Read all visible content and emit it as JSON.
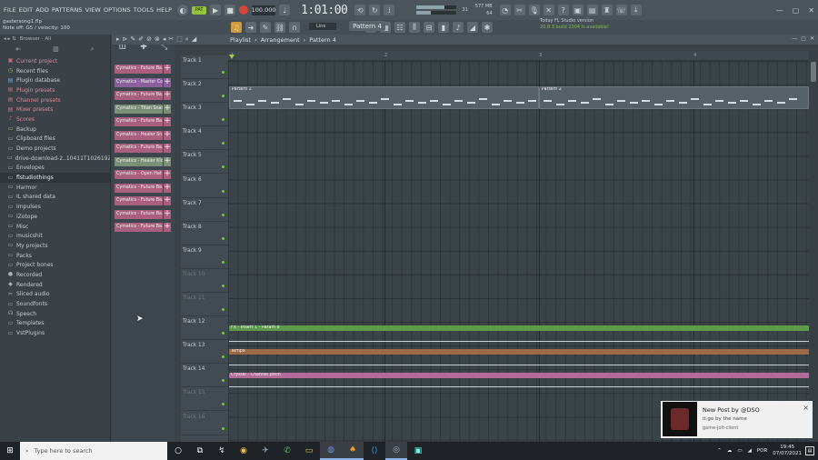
{
  "menu": [
    "FILE",
    "EDIT",
    "ADD",
    "PATTERNS",
    "VIEW",
    "OPTIONS",
    "TOOLS",
    "HELP"
  ],
  "transport": {
    "pat_label": "PAT",
    "tempo": "100.000",
    "time": "1:01:00"
  },
  "cpu": {
    "mem": "577 MB",
    "voices": "64",
    "cpu_num": "31"
  },
  "file": {
    "name": "gastersong1.flp",
    "hint": "Note off: G5 / velocity: 100"
  },
  "pattern_selector": "Pattern 4",
  "snap": "Line",
  "news": {
    "line1": "Today   FL Studio version",
    "line2": "20.8.3 build 2304 is available!"
  },
  "browser": {
    "title": "Browser - All",
    "items": [
      {
        "label": "Current project",
        "icon": "project-icon",
        "style": "pink"
      },
      {
        "label": "Recent files",
        "icon": "recent-icon",
        "style": "green"
      },
      {
        "label": "Plugin database",
        "icon": "plugin-db-icon",
        "style": "blue"
      },
      {
        "label": "Plugin presets",
        "icon": "plugin-preset-icon",
        "style": "pink"
      },
      {
        "label": "Channel presets",
        "icon": "channel-preset-icon",
        "style": "pink"
      },
      {
        "label": "Mixer presets",
        "icon": "mixer-preset-icon",
        "style": "pink"
      },
      {
        "label": "Scores",
        "icon": "score-icon",
        "style": "pink"
      },
      {
        "label": "Backup",
        "icon": "folder-icon",
        "style": "green"
      },
      {
        "label": "Clipboard files",
        "icon": "folder-icon",
        "style": ""
      },
      {
        "label": "Demo projects",
        "icon": "folder-icon",
        "style": ""
      },
      {
        "label": "drive-download-2..10411T102619Z-001",
        "icon": "folder-icon",
        "style": ""
      },
      {
        "label": "Envelopes",
        "icon": "folder-icon",
        "style": ""
      },
      {
        "label": "flstudiothings",
        "icon": "folder-icon",
        "style": "hl"
      },
      {
        "label": "Harmor",
        "icon": "folder-icon",
        "style": ""
      },
      {
        "label": "IL shared data",
        "icon": "folder-icon",
        "style": ""
      },
      {
        "label": "Impulses",
        "icon": "folder-icon",
        "style": ""
      },
      {
        "label": "iZotope",
        "icon": "folder-icon",
        "style": ""
      },
      {
        "label": "Misc",
        "icon": "folder-icon",
        "style": ""
      },
      {
        "label": "musicshit",
        "icon": "folder-icon",
        "style": ""
      },
      {
        "label": "My projects",
        "icon": "folder-icon",
        "style": ""
      },
      {
        "label": "Packs",
        "icon": "folder-icon",
        "style": "blue"
      },
      {
        "label": "Project bones",
        "icon": "folder-icon",
        "style": ""
      },
      {
        "label": "Recorded",
        "icon": "recorded-icon",
        "style": ""
      },
      {
        "label": "Rendered",
        "icon": "rendered-icon",
        "style": ""
      },
      {
        "label": "Sliced audio",
        "icon": "sliced-icon",
        "style": ""
      },
      {
        "label": "Soundfonts",
        "icon": "folder-icon",
        "style": ""
      },
      {
        "label": "Speech",
        "icon": "speech-icon",
        "style": ""
      },
      {
        "label": "Templates",
        "icon": "folder-icon",
        "style": ""
      },
      {
        "label": "VstPlugins",
        "icon": "folder-icon",
        "style": ""
      }
    ]
  },
  "channels": [
    {
      "name": "Cymatics - Future Ba...",
      "color": "#a9607e"
    },
    {
      "name": "Cymatics - Master Co...",
      "color": "#8a5f9c"
    },
    {
      "name": "Cymatics - Future Ba...",
      "color": "#a9607e"
    },
    {
      "name": "Cymatics - Titan Snar...",
      "color": "#7b8f77"
    },
    {
      "name": "Cymatics - Future Ba...",
      "color": "#a9607e"
    },
    {
      "name": "Cymatics - Healer Sn...",
      "color": "#a9607e"
    },
    {
      "name": "Cymatics - Future Ba...",
      "color": "#a9607e"
    },
    {
      "name": "Cymatics - Healer Kic...",
      "color": "#7b8f77"
    },
    {
      "name": "Cymatics - Open Hat S...",
      "color": "#a9607e"
    },
    {
      "name": "Cymatics - Future Ba...",
      "color": "#a9607e"
    },
    {
      "name": "Cymatics - Future Ba...",
      "color": "#a9607e"
    },
    {
      "name": "Cymatics - Future Ba...",
      "color": "#a9607e"
    },
    {
      "name": "Cymatics - Future Ba...",
      "color": "#a9607e"
    }
  ],
  "playlist": {
    "title": "Playlist",
    "breadcrumb": [
      "Arrangement",
      "Pattern 4"
    ]
  },
  "ruler": [
    "1",
    "2",
    "3",
    "4"
  ],
  "tracks": [
    {
      "name": "Track 1",
      "dim": false
    },
    {
      "name": "Track 2",
      "dim": false
    },
    {
      "name": "Track 3",
      "dim": false
    },
    {
      "name": "Track 4",
      "dim": false
    },
    {
      "name": "Track 5",
      "dim": false
    },
    {
      "name": "Track 6",
      "dim": false
    },
    {
      "name": "Track 7",
      "dim": false
    },
    {
      "name": "Track 8",
      "dim": false
    },
    {
      "name": "Track 9",
      "dim": false
    },
    {
      "name": "Track 10",
      "dim": true
    },
    {
      "name": "Track 11",
      "dim": true
    },
    {
      "name": "Track 12",
      "dim": false
    },
    {
      "name": "Track 13",
      "dim": false
    },
    {
      "name": "Track 14",
      "dim": false
    },
    {
      "name": "Track 15",
      "dim": true
    },
    {
      "name": "Track 16",
      "dim": true
    }
  ],
  "clips": {
    "pattern_a": "Pattern 2",
    "pattern_b": "Pattern 2",
    "auto_fx": "FX - Insert 1 - Param 8",
    "auto_tempo": "Tempo",
    "auto_crystal": "Crystal - Channel pitch"
  },
  "toast": {
    "title": "New Post by @DSO",
    "body": "it.go by the name",
    "app": "game-jolt-client",
    "close": "×"
  },
  "taskbar": {
    "search_placeholder": "Type here to search",
    "lang": "POR",
    "time": "19:45",
    "date": "07/07/2021"
  }
}
